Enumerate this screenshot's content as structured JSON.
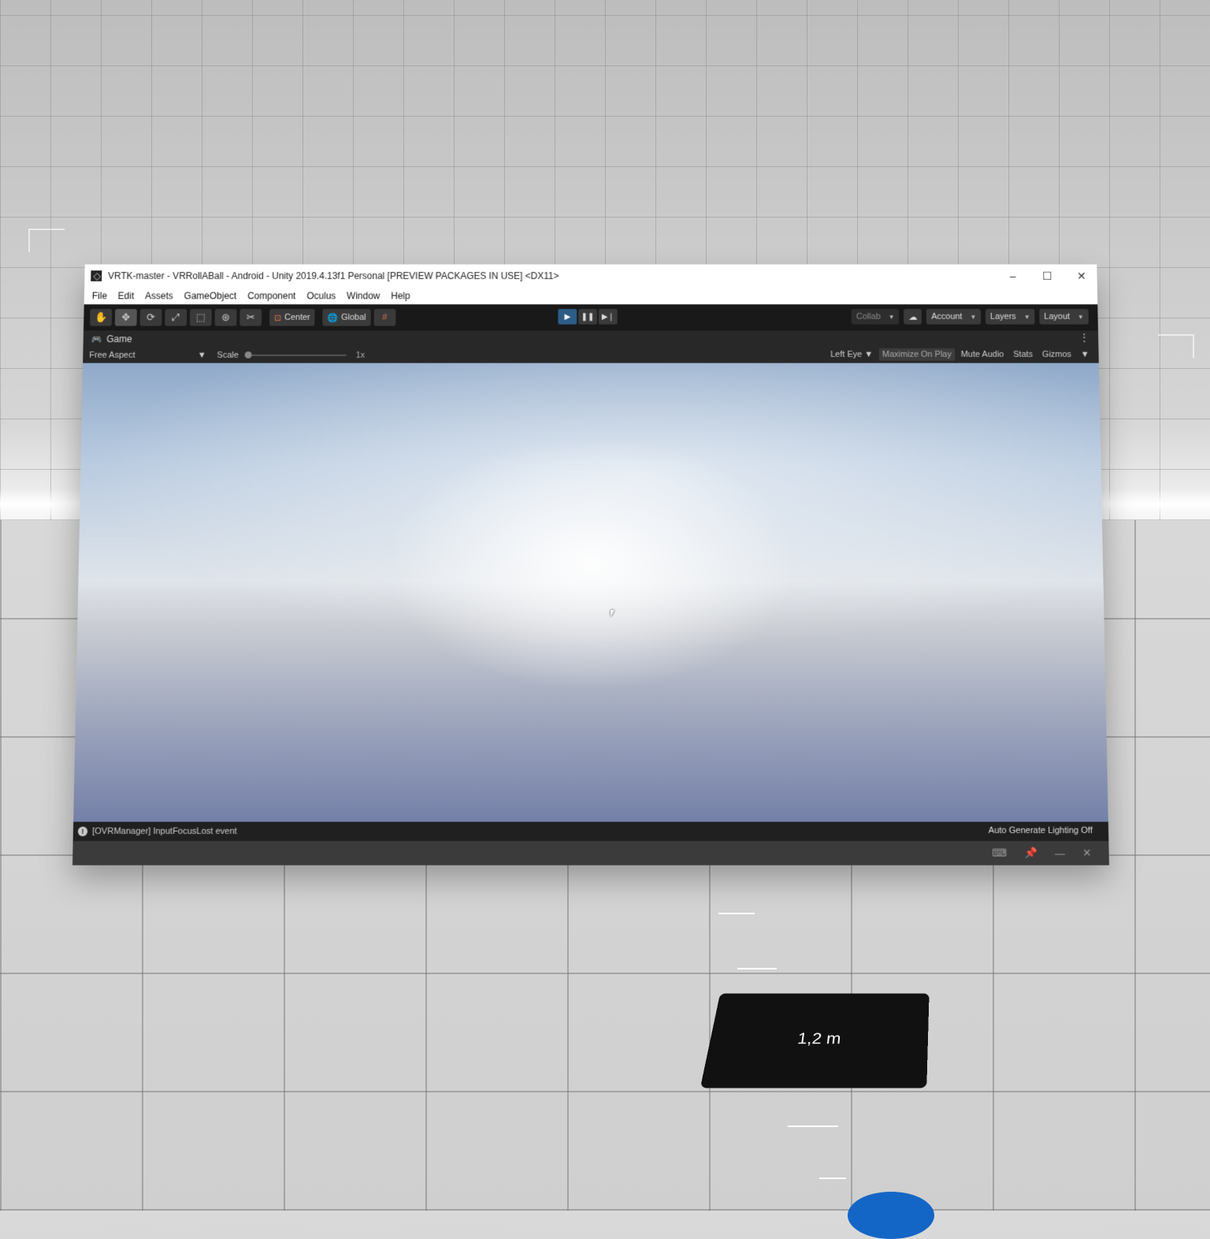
{
  "window": {
    "title": "VRTK-master - VRRollABall - Android - Unity 2019.4.13f1 Personal [PREVIEW PACKAGES IN USE] <DX11>",
    "controls": {
      "minimize": "–",
      "maximize": "☐",
      "close": "✕"
    }
  },
  "menu": [
    "File",
    "Edit",
    "Assets",
    "GameObject",
    "Component",
    "Oculus",
    "Window",
    "Help"
  ],
  "toolbar": {
    "tools": [
      "hand-icon",
      "move-icon",
      "rotate-icon",
      "scale-icon",
      "rect-icon",
      "transform-icon",
      "custom-tool-icon"
    ],
    "pivot_label": "Center",
    "space_label": "Global",
    "collab_label": "Collab",
    "account_label": "Account",
    "layers_label": "Layers",
    "layout_label": "Layout"
  },
  "game_view": {
    "tab_label": "Game",
    "aspect_label": "Free Aspect",
    "scale_label": "Scale",
    "scale_value": "1x",
    "eye_label": "Left Eye",
    "maximize_label": "Maximize On Play",
    "mute_label": "Mute Audio",
    "stats_label": "Stats",
    "gizmos_label": "Gizmos"
  },
  "status": {
    "message": "[OVRManager] InputFocusLost event",
    "lighting": "Auto Generate Lighting Off"
  },
  "vr": {
    "distance_label": "1,2 m"
  },
  "colors": {
    "play_active": "#2c5d87",
    "distance_panel": "#111111",
    "blue_marker": "#1466c6"
  }
}
